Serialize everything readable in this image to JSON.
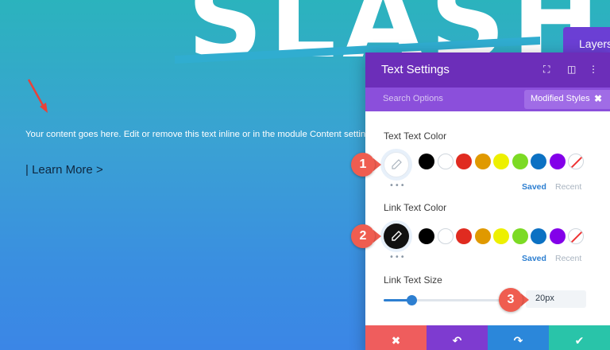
{
  "hero": {
    "title": "SLASH"
  },
  "content": {
    "body": "Your content goes here. Edit or remove this text inline or in the module Content settings. You can also style every aspect of this content in the module Design settings and even apply custom CSS to this text in the module Advanced settings.",
    "link": "| Learn More >"
  },
  "layers": {
    "label": "Layers"
  },
  "panel": {
    "title": "Text Settings",
    "search_placeholder": "Search Options",
    "modified_label": "Modified Styles",
    "text_color": {
      "label": "Text Text Color",
      "saved": "Saved",
      "recent": "Recent"
    },
    "link_color": {
      "label": "Link Text Color",
      "saved": "Saved",
      "recent": "Recent"
    },
    "link_size": {
      "label": "Link Text Size",
      "value": "20px",
      "slider_fraction": 0.23
    },
    "palette": [
      "#000000",
      "#ffffff",
      "#e02b20",
      "#e09900",
      "#edf000",
      "#7cda24",
      "#0c71c3",
      "#8300e9",
      "none"
    ]
  },
  "badges": [
    "1",
    "2",
    "3"
  ],
  "colors": {
    "accent": "#6c2eb9",
    "badge": "#ef5d50",
    "cancel": "#ef5d5d",
    "undo": "#7e3bd0",
    "redo": "#2b87da",
    "save": "#29c4a9"
  }
}
